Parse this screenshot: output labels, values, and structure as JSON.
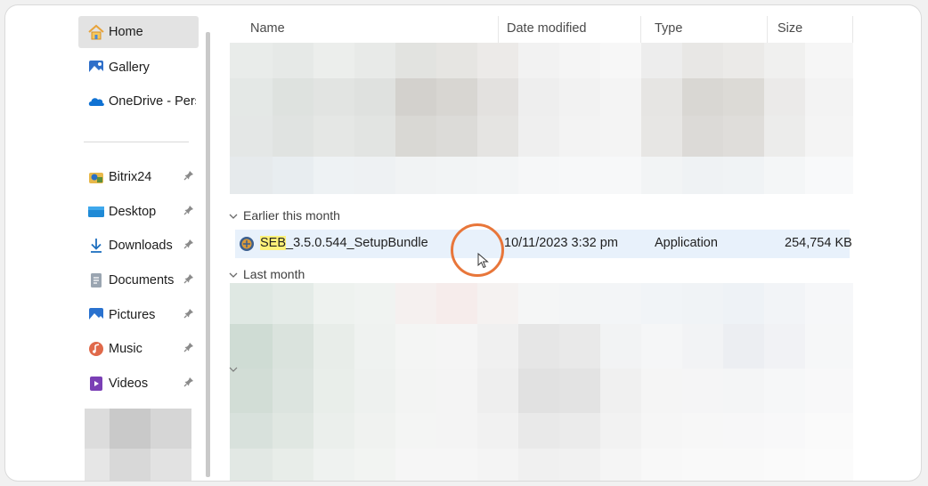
{
  "sidebar": {
    "items": [
      {
        "label": "Home",
        "icon": "home-icon",
        "pinned": false,
        "active": true
      },
      {
        "label": "Gallery",
        "icon": "gallery-icon",
        "pinned": false
      },
      {
        "label": "OneDrive - Perso",
        "icon": "onedrive-icon",
        "pinned": false
      },
      {
        "label": "Bitrix24",
        "icon": "bitrix-folder-icon",
        "pinned": true
      },
      {
        "label": "Desktop",
        "icon": "desktop-folder-icon",
        "pinned": true
      },
      {
        "label": "Downloads",
        "icon": "download-icon",
        "pinned": true
      },
      {
        "label": "Documents",
        "icon": "documents-icon",
        "pinned": true
      },
      {
        "label": "Pictures",
        "icon": "pictures-icon",
        "pinned": true
      },
      {
        "label": "Music",
        "icon": "music-icon",
        "pinned": true
      },
      {
        "label": "Videos",
        "icon": "videos-icon",
        "pinned": true
      }
    ]
  },
  "columns": {
    "name": "Name",
    "date": "Date modified",
    "type": "Type",
    "size": "Size"
  },
  "groups": {
    "earlier": "Earlier this month",
    "last": "Last month"
  },
  "file": {
    "name_highlight": "SEB",
    "name_rest": "_3.5.0.544_SetupBundle",
    "date": "10/11/2023 3:32 pm",
    "type": "Application",
    "size": "254,754 KB",
    "icon": "seb-app-icon"
  },
  "colors": {
    "accent_ring": "#e8763a",
    "selection": "#e8f1fb",
    "highlight": "#fff27a"
  }
}
